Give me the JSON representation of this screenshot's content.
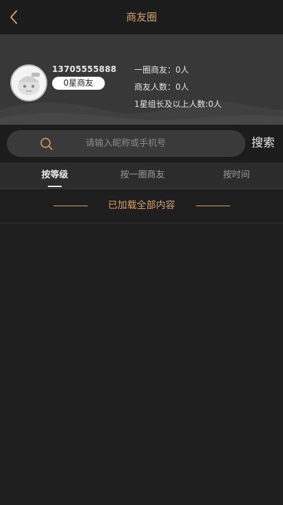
{
  "header": {
    "title": "商友圈"
  },
  "profile": {
    "phone": "13705555888",
    "level": "0星商友",
    "stats": [
      {
        "label": "一圈商友：",
        "value": "0人"
      },
      {
        "label": "商友人数：",
        "value": "0人"
      },
      {
        "label": "1星组长及以上人数:",
        "value": "0人"
      }
    ]
  },
  "search": {
    "placeholder": "请输入昵称或手机号",
    "button_label": "搜索"
  },
  "tabs": [
    {
      "label": "按等级",
      "active": true
    },
    {
      "label": "按一圈商友",
      "active": false
    },
    {
      "label": "按时间",
      "active": false
    }
  ],
  "list": {
    "end_text": "已加载全部内容"
  },
  "colors": {
    "accent": "#d5a06a",
    "background": "#1e1e1e"
  }
}
